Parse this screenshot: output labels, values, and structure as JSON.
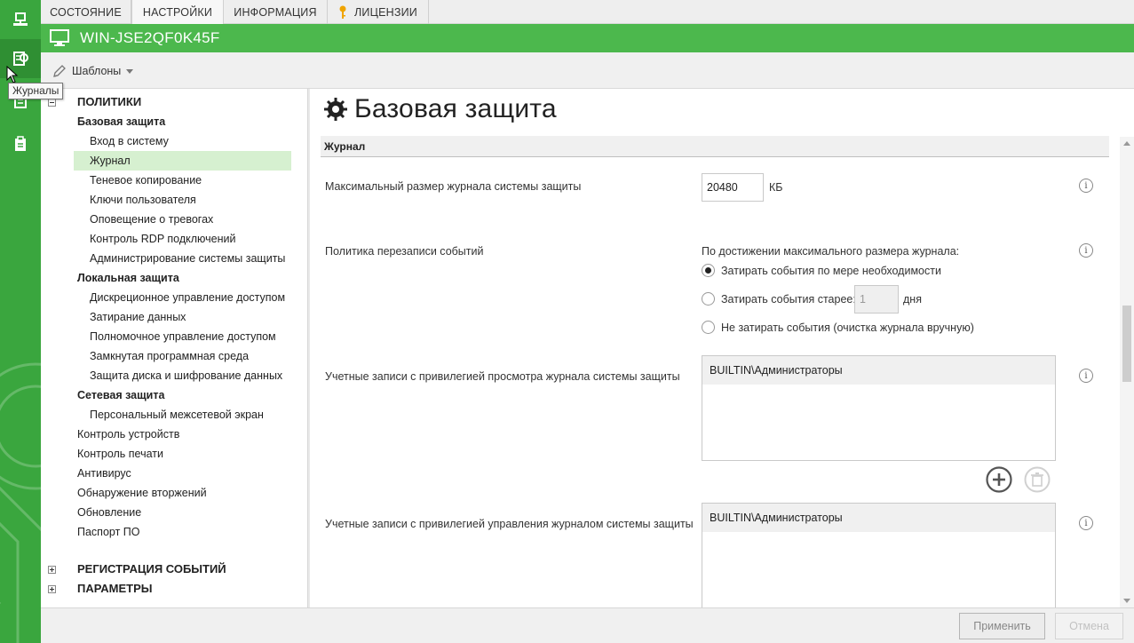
{
  "tabs": [
    "СОСТОЯНИЕ",
    "НАСТРОЙКИ",
    "ИНФОРМАЦИЯ",
    "ЛИЦЕНЗИИ"
  ],
  "host": {
    "name": "WIN-JSE2QF0K45F"
  },
  "toolbar": {
    "templates_label": "Шаблоны"
  },
  "tooltip": {
    "text": "Журналы"
  },
  "tree": {
    "policies": "ПОЛИТИКИ",
    "base_protection": "Базовая защита",
    "base_items": [
      "Вход в систему",
      "Журнал",
      "Теневое копирование",
      "Ключи пользователя",
      "Оповещение о тревогах",
      "Контроль RDP подключений",
      "Администрирование системы защиты"
    ],
    "local_protection": "Локальная защита",
    "local_items": [
      "Дискреционное управление доступом",
      "Затирание данных",
      "Полномочное управление доступом",
      "Замкнутая программная среда",
      "Защита диска и шифрование данных"
    ],
    "network_protection": "Сетевая защита",
    "network_items": [
      "Персональный межсетевой экран"
    ],
    "other_items": [
      "Контроль устройств",
      "Контроль печати",
      "Антивирус",
      "Обнаружение вторжений",
      "Обновление",
      "Паспорт ПО"
    ],
    "event_registration": "РЕГИСТРАЦИЯ СОБЫТИЙ",
    "parameters": "ПАРАМЕТРЫ"
  },
  "main": {
    "title": "Базовая защита",
    "section": "Журнал",
    "max_size": {
      "label": "Максимальный размер журнала системы защиты",
      "value": "20480",
      "unit": "КБ"
    },
    "overwrite": {
      "label": "Политика перезаписи событий",
      "caption": "По достижении максимального размера журнала:",
      "options": [
        "Затирать события по мере необходимости",
        "Затирать события старее:",
        "Не затирать события (очистка журнала вручную)"
      ],
      "selected_index": 0,
      "days_value": "1",
      "days_unit": "дня"
    },
    "view_accounts": {
      "label": "Учетные записи с привилегией просмотра журнала системы защиты",
      "items": [
        "BUILTIN\\Администраторы"
      ]
    },
    "manage_accounts": {
      "label": "Учетные записи с привилегией управления журналом системы защиты",
      "items": [
        "BUILTIN\\Администраторы"
      ]
    }
  },
  "footer": {
    "apply": "Применить",
    "cancel": "Отмена"
  },
  "colors": {
    "green_header": "#4cb84d",
    "rail_green": "#3aa63e",
    "selection": "#d6f0d0"
  }
}
